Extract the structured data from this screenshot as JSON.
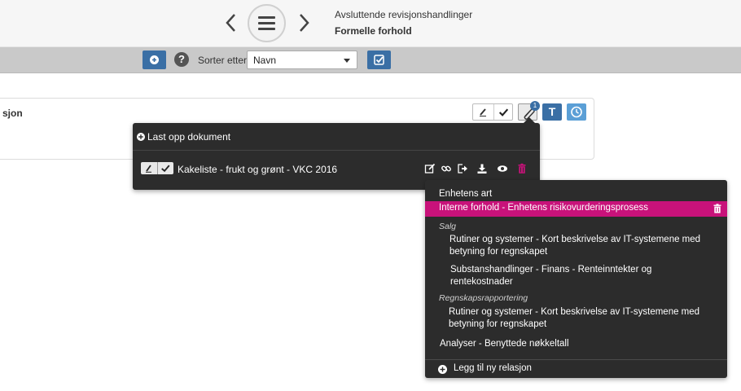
{
  "header": {
    "breadcrumb_parent": "Avsluttende revisjonshandlinger",
    "breadcrumb_current": "Formelle forhold",
    "icons": [
      "chevron-left-icon",
      "hamburger-menu-icon",
      "chevron-right-icon"
    ]
  },
  "toolbar": {
    "sort_label": "Sorter etter",
    "sort_value": "Navn",
    "icons": [
      "plus-icon",
      "help-icon",
      "check-square-icon"
    ]
  },
  "card": {
    "title_fragment": "sjon",
    "attachment_count": "1",
    "type_button": "T"
  },
  "document_popup": {
    "upload_label": "Last opp dokument",
    "document_name": "Kakeliste - frukt og grønt - VKC 2016",
    "action_icons": [
      "edit-icon",
      "link-icon",
      "share-icon",
      "download-icon",
      "eye-icon",
      "trash-icon"
    ]
  },
  "relations": {
    "item_1": "Enhetens art",
    "highlighted": "Interne forhold - Enhetens risikovurderingsprosess",
    "group_1": "Salg",
    "item_2_line1": "Rutiner og systemer - Kort beskrivelse av IT-systemene med",
    "item_2_line2": "betyning for regnskapet",
    "item_3_line1": "Substanshandlinger - Finans - Renteinntekter og",
    "item_3_line2": "rentekostnader",
    "group_2": "Regnskapsrapportering",
    "item_4_line1": "Rutiner og systemer - Kort beskrivelse av IT-systemene med",
    "item_4_line2": "betyning for regnskapet",
    "item_5": "Analyser - Benyttede nøkkeltall",
    "add_label": "Legg til ny relasjon"
  },
  "colors": {
    "primary": "#3a6fa5",
    "highlight": "#c8127a",
    "popup_bg": "#2c2c2c"
  }
}
